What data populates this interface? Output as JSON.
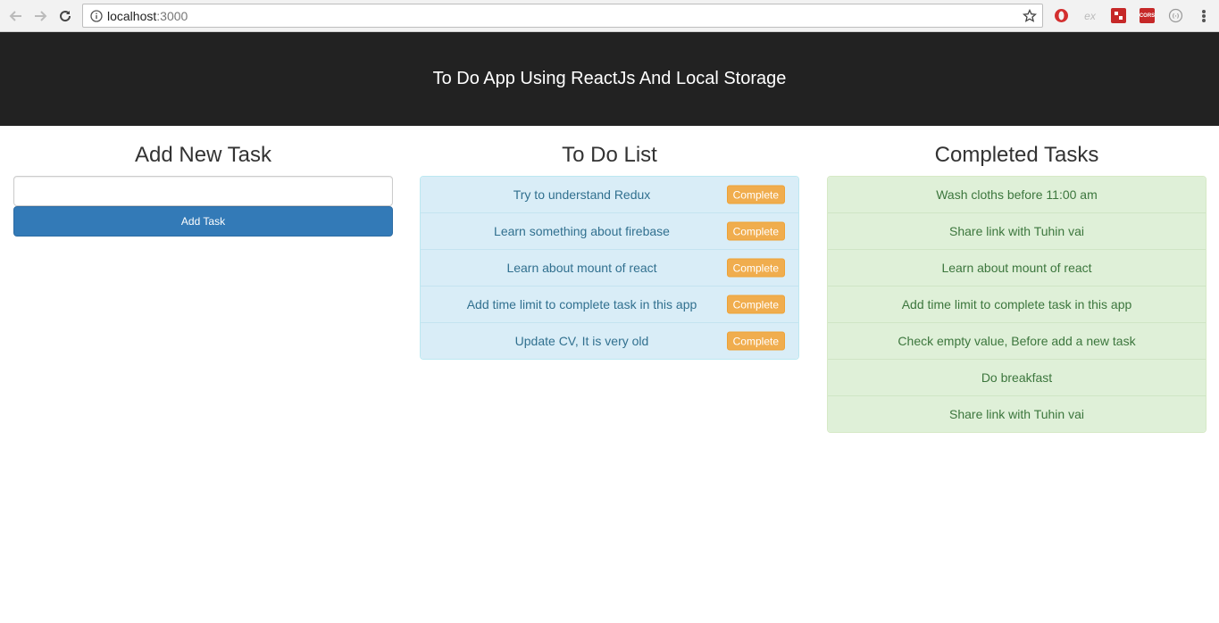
{
  "browser": {
    "url_host": "localhost",
    "url_port": ":3000",
    "extensions": [
      "opera-icon",
      "ex-icon",
      "red-extension-icon",
      "cors-icon",
      "circle-extension-icon"
    ],
    "ex_label": "ex",
    "cors_label": "CORS"
  },
  "header": {
    "title": "To Do App Using ReactJs And Local Storage"
  },
  "add_task": {
    "heading": "Add New Task",
    "input_value": "",
    "input_placeholder": "",
    "button_label": "Add Task"
  },
  "todo": {
    "heading": "To Do List",
    "complete_label": "Complete",
    "items": [
      "Try to understand Redux",
      "Learn something about firebase",
      "Learn about mount of react",
      "Add time limit to complete task in this app",
      "Update CV, It is very old"
    ]
  },
  "completed": {
    "heading": "Completed Tasks",
    "items": [
      "Wash cloths before 11:00 am",
      "Share link with Tuhin vai",
      "Learn about mount of react",
      "Add time limit to complete task in this app",
      "Check empty value, Before add a new task",
      "Do breakfast",
      "Share link with Tuhin vai"
    ]
  },
  "colors": {
    "header_bg": "#222222",
    "primary": "#337ab7",
    "warning": "#f0ad4e",
    "info_bg": "#d9edf7",
    "success_bg": "#dff0d8"
  }
}
